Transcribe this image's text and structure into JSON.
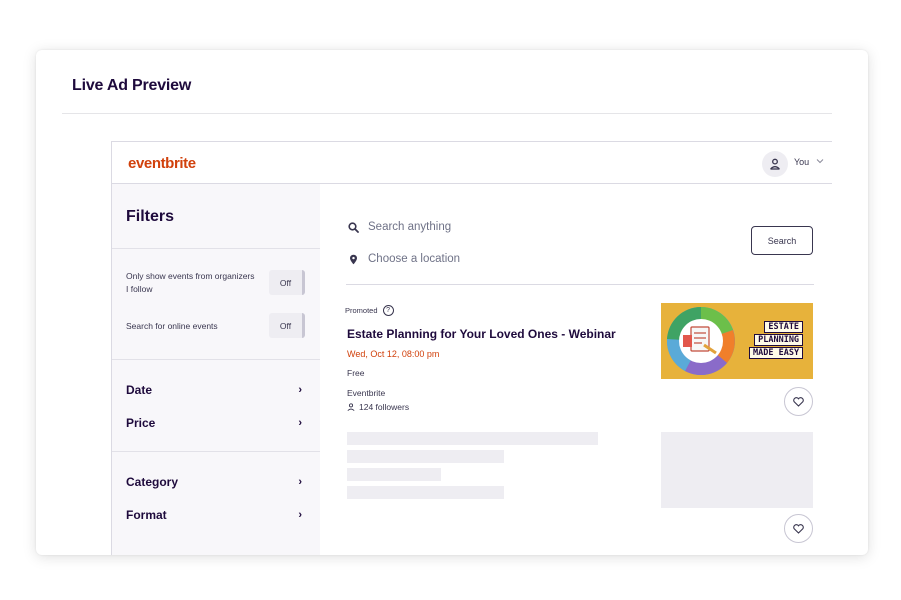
{
  "card": {
    "title": "Live Ad Preview"
  },
  "header": {
    "logo": "eventbrite",
    "user_label": "You",
    "icons": {
      "user": "user-icon",
      "chevron": "chevron-down-icon"
    }
  },
  "sidebar": {
    "title": "Filters",
    "toggles": [
      {
        "label": "Only show events from organizers I follow",
        "value": "Off"
      },
      {
        "label": "Search for online events",
        "value": "Off"
      }
    ],
    "sections": [
      {
        "label": "Date"
      },
      {
        "label": "Price"
      },
      {
        "label": "Category"
      },
      {
        "label": "Format"
      }
    ]
  },
  "search": {
    "query_placeholder": "Search anything",
    "location_placeholder": "Choose a location",
    "button_label": "Search"
  },
  "event": {
    "promoted_label": "Promoted",
    "title": "Estate Planning for Your Loved Ones - Webinar",
    "date": "Wed, Oct 12, 08:00 pm",
    "price": "Free",
    "organizer": "Eventbrite",
    "followers": "124 followers",
    "image_text": [
      "ESTATE",
      "PLANNING",
      "MADE EASY"
    ]
  },
  "colors": {
    "brand": "#d1410c",
    "text": "#1e0a3c",
    "sidebar_bg": "#f8f7fa",
    "image_bg": "#e7b23b",
    "skeleton": "#eeedf2"
  }
}
